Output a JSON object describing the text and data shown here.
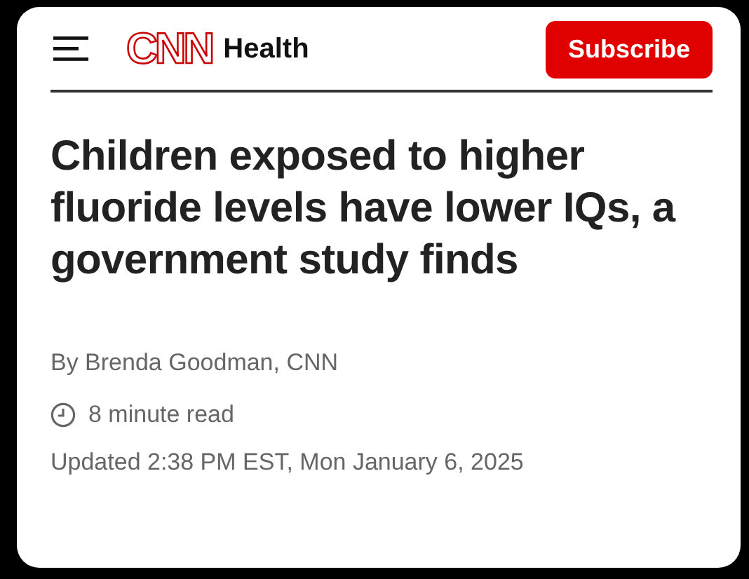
{
  "header": {
    "logo": "CNN",
    "section": "Health",
    "subscribe": "Subscribe"
  },
  "article": {
    "headline": "Children exposed to higher fluoride levels have lower IQs, a government study finds",
    "byline": "By Brenda Goodman, CNN",
    "read_time": "8 minute read",
    "updated": "Updated 2:38 PM EST, Mon January 6, 2025"
  }
}
